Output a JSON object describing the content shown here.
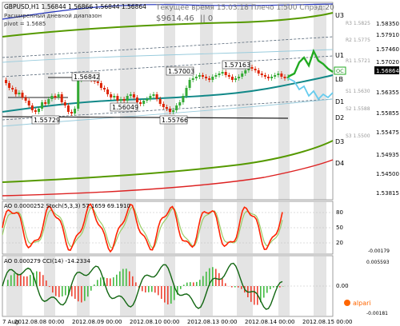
{
  "header": {
    "symbol_line": "GBPUSD,H1  1.56844 1.56866 1.56844 1.56864",
    "indicator_name": "Расширенный дневной диапазон",
    "pivot_label": "pivot = 1.5685",
    "balance": "$9614.46",
    "balance_extra": "|| 0",
    "time_spread": "Текущее время 15.03.18 Плечо 1:500 Спрэд:20"
  },
  "level_labels": {
    "u3": "U3",
    "u1": "U1",
    "lb": "LB",
    "d1": "D1",
    "d2": "D2",
    "d3": "D3",
    "d4": "D4",
    "oc": "OC"
  },
  "small_labels": {
    "r3": "R3 1.5825",
    "r2": "R2 1.5775",
    "r1": "R1 1.5721",
    "s1": "S1 1.5630",
    "s2": "S2 1.5588",
    "s3": "S3 1.5500"
  },
  "price_annotations": [
    "1.55729",
    "1.56842",
    "1.56049",
    "1.55766",
    "1.57003",
    "1.57163"
  ],
  "price_axis": {
    "main": [
      "1.58350",
      "1.57910",
      "1.57460",
      "1.57020",
      "1.56864",
      "1.56355",
      "1.55855",
      "1.55475",
      "1.54935",
      "1.54500",
      "1.53815"
    ],
    "current": "1.56864"
  },
  "stoch_panel": {
    "label": "AO 0.0000252  Stoch(5,3,3) 57.1659 69.1910",
    "axis": [
      "80",
      "50",
      "20",
      "-0.00179"
    ]
  },
  "ao_panel": {
    "label": "AO 0.000279  CCI(14) -14.2334",
    "axis": [
      "0.005593",
      "0.00",
      "-0.00181"
    ]
  },
  "time_axis": [
    "7 Aug",
    "2012.08.08 00:00",
    "2012.08.09 00:00",
    "2012.08.10 00:00",
    "2012.08.13 00:00",
    "2012.08.14 00:00",
    "2012.08.15 00:00"
  ],
  "brand": "alpari",
  "colors": {
    "bull_candle": "#33aa33",
    "bear_candle": "#dd2200",
    "green_channel": "#559900",
    "red_channel": "#dd2222",
    "blue_channel": "#2233bb",
    "teal_ma": "#118888",
    "forecast": "#22aa22",
    "forecast_alt": "#66ccee",
    "stoch_fast": "#ff2200",
    "stoch_slow": "#99cc66",
    "cci": "#116611"
  }
}
